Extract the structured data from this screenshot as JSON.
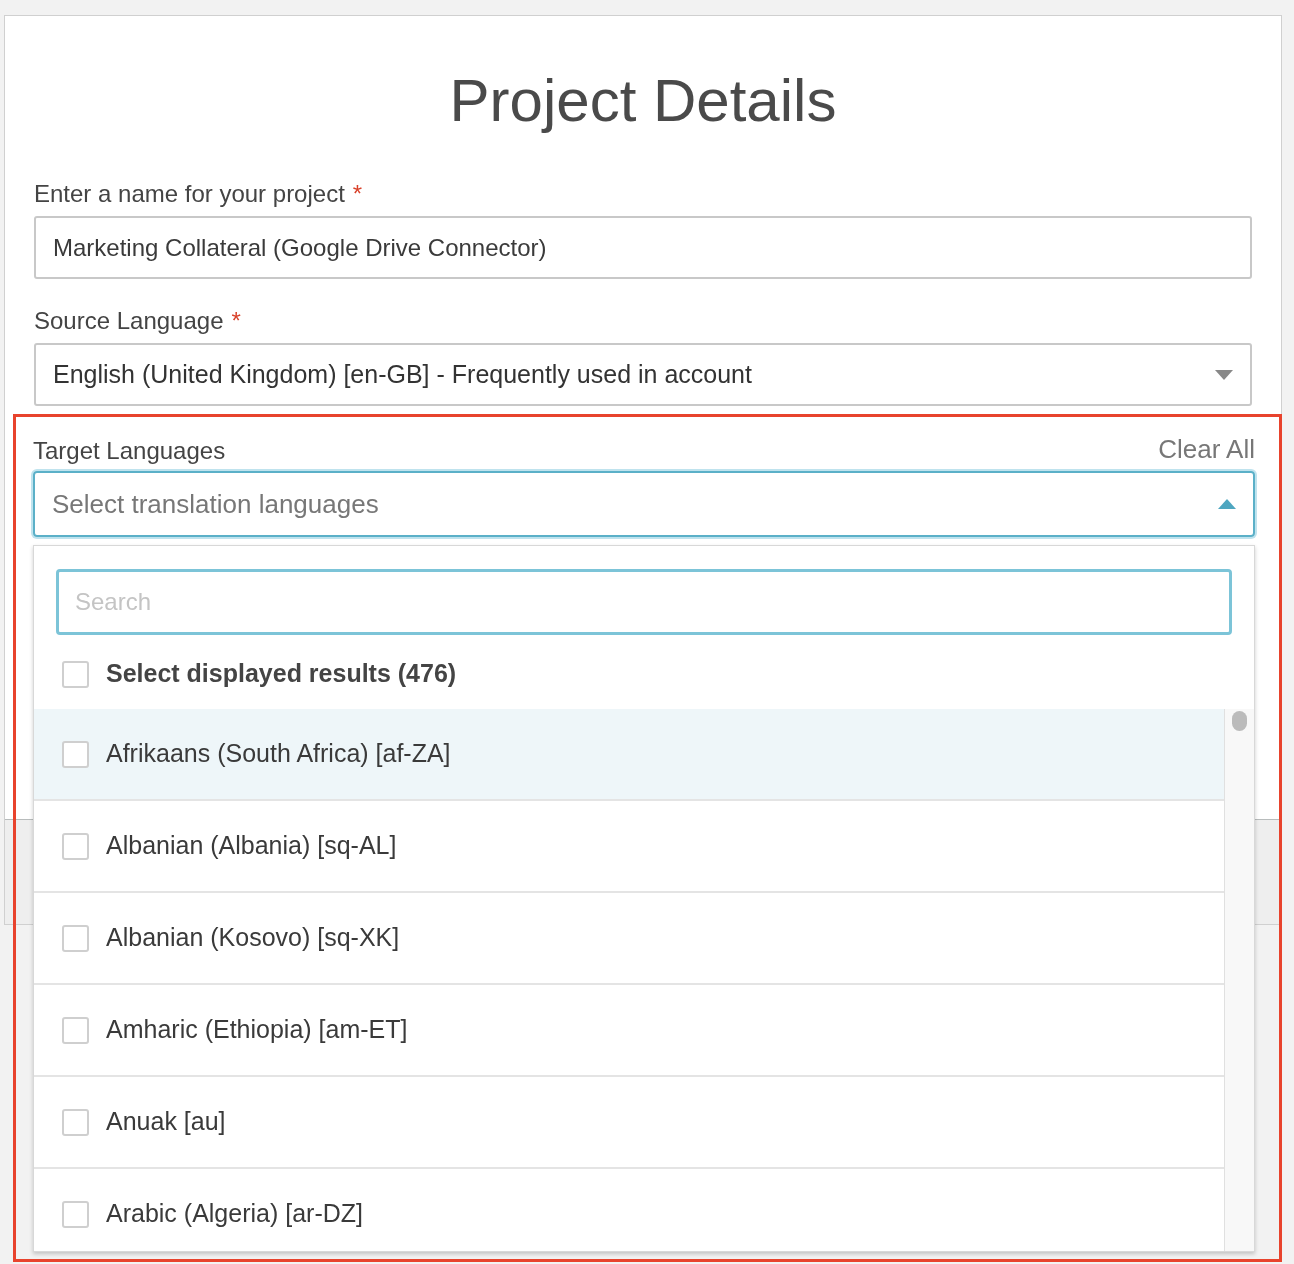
{
  "title": "Project Details",
  "project_name": {
    "label": "Enter a name for your project",
    "required": true,
    "required_mark": "*",
    "value": "Marketing Collateral (Google Drive Connector)"
  },
  "source_language": {
    "label": "Source Language",
    "required": true,
    "required_mark": "*",
    "value": "English (United Kingdom) [en-GB] - Frequently used in account"
  },
  "target_languages": {
    "label": "Target Languages",
    "clear_label": "Clear All",
    "placeholder": "Select translation languages",
    "expanded": true,
    "dropdown": {
      "search": {
        "placeholder": "Search"
      },
      "select_all": {
        "label": "Select displayed results (476)",
        "checked": false
      },
      "options": [
        {
          "label": "Afrikaans (South Africa) [af-ZA]",
          "checked": false,
          "highlighted": true
        },
        {
          "label": "Albanian (Albania) [sq-AL]",
          "checked": false,
          "highlighted": false
        },
        {
          "label": "Albanian (Kosovo) [sq-XK]",
          "checked": false,
          "highlighted": false
        },
        {
          "label": "Amharic (Ethiopia) [am-ET]",
          "checked": false,
          "highlighted": false
        },
        {
          "label": "Anuak [au]",
          "checked": false,
          "highlighted": false
        },
        {
          "label": "Arabic (Algeria) [ar-DZ]",
          "checked": false,
          "highlighted": false
        }
      ]
    }
  }
}
